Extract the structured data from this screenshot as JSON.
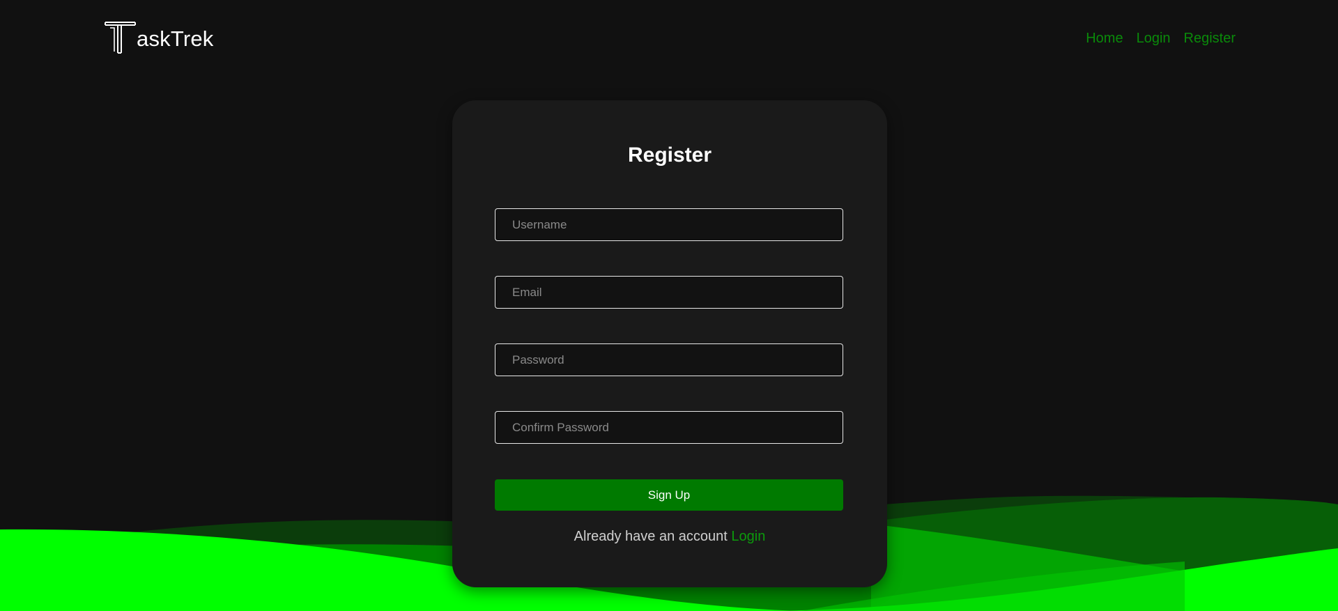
{
  "brand": {
    "name": "askTrek",
    "logo_letter": "T"
  },
  "nav": {
    "links": [
      {
        "label": "Home"
      },
      {
        "label": "Login"
      },
      {
        "label": "Register"
      }
    ]
  },
  "form": {
    "title": "Register",
    "fields": [
      {
        "placeholder": "Username",
        "value": ""
      },
      {
        "placeholder": "Email",
        "value": ""
      },
      {
        "placeholder": "Password",
        "value": ""
      },
      {
        "placeholder": "Confirm Password",
        "value": ""
      }
    ],
    "submit_label": "Sign Up",
    "account_prompt": "Already have an account",
    "login_link": "Login"
  },
  "colors": {
    "background": "#111111",
    "card": "#1a1a1a",
    "accent": "#007a00",
    "link": "#0a8a0a",
    "wave_bright": "#00ff00"
  }
}
